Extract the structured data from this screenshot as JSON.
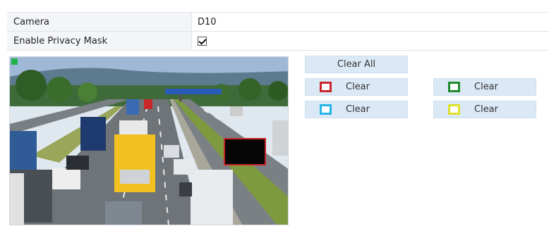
{
  "form": {
    "camera_label": "Camera",
    "camera_value": "D10",
    "privacy_label": "Enable Privacy Mask",
    "privacy_enabled": true
  },
  "preview": {
    "mask_colors": [
      "#c8262b"
    ]
  },
  "buttons": {
    "clear_all": "Clear All",
    "clear_red": "Clear",
    "clear_green": "Clear",
    "clear_cyan": "Clear",
    "clear_yellow": "Clear"
  },
  "colors": {
    "red": "#c8262b",
    "green": "#1f8a2a",
    "cyan": "#27b4e6",
    "yellow": "#dfe02a",
    "button_bg": "#dbe9f7"
  }
}
